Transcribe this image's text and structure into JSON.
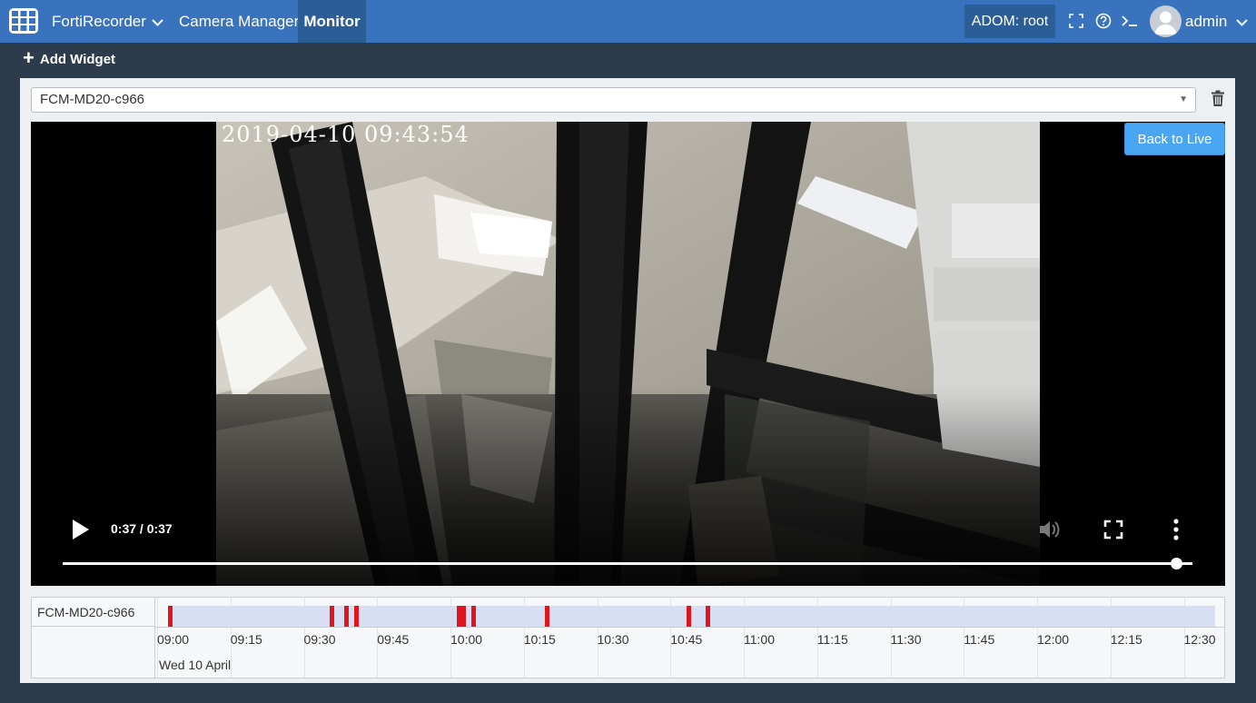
{
  "nav": {
    "product": "FortiRecorder",
    "camera_manager": "Camera Manager",
    "monitor": "Monitor",
    "adom": "ADOM: root",
    "user": "admin"
  },
  "toolbar": {
    "add_widget": "Add Widget"
  },
  "widget": {
    "camera_select": "FCM-MD20-c966",
    "back_to_live": "Back to Live",
    "osd_timestamp": "2019-04-10 09:43:54",
    "player_time": "0:37 / 0:37",
    "progress": 1.0
  },
  "timeline": {
    "camera": "FCM-MD20-c966",
    "ticks": [
      "09:00",
      "09:15",
      "09:30",
      "09:45",
      "10:00",
      "10:15",
      "10:30",
      "10:45",
      "11:00",
      "11:15",
      "11:30",
      "11:45",
      "12:00",
      "12:15",
      "12:30"
    ],
    "date": "Wed 10 April",
    "events": [
      "09:00",
      "09:33",
      "09:36",
      "09:38",
      "09:59",
      "10:00",
      "10:02",
      "10:17",
      "10:46",
      "10:50"
    ],
    "event_color": "#e0161e"
  },
  "colors": {
    "nav": "#3a73bd",
    "nav_active": "#2b5d97",
    "button": "#4aa6f2",
    "track": "#d8def3"
  }
}
